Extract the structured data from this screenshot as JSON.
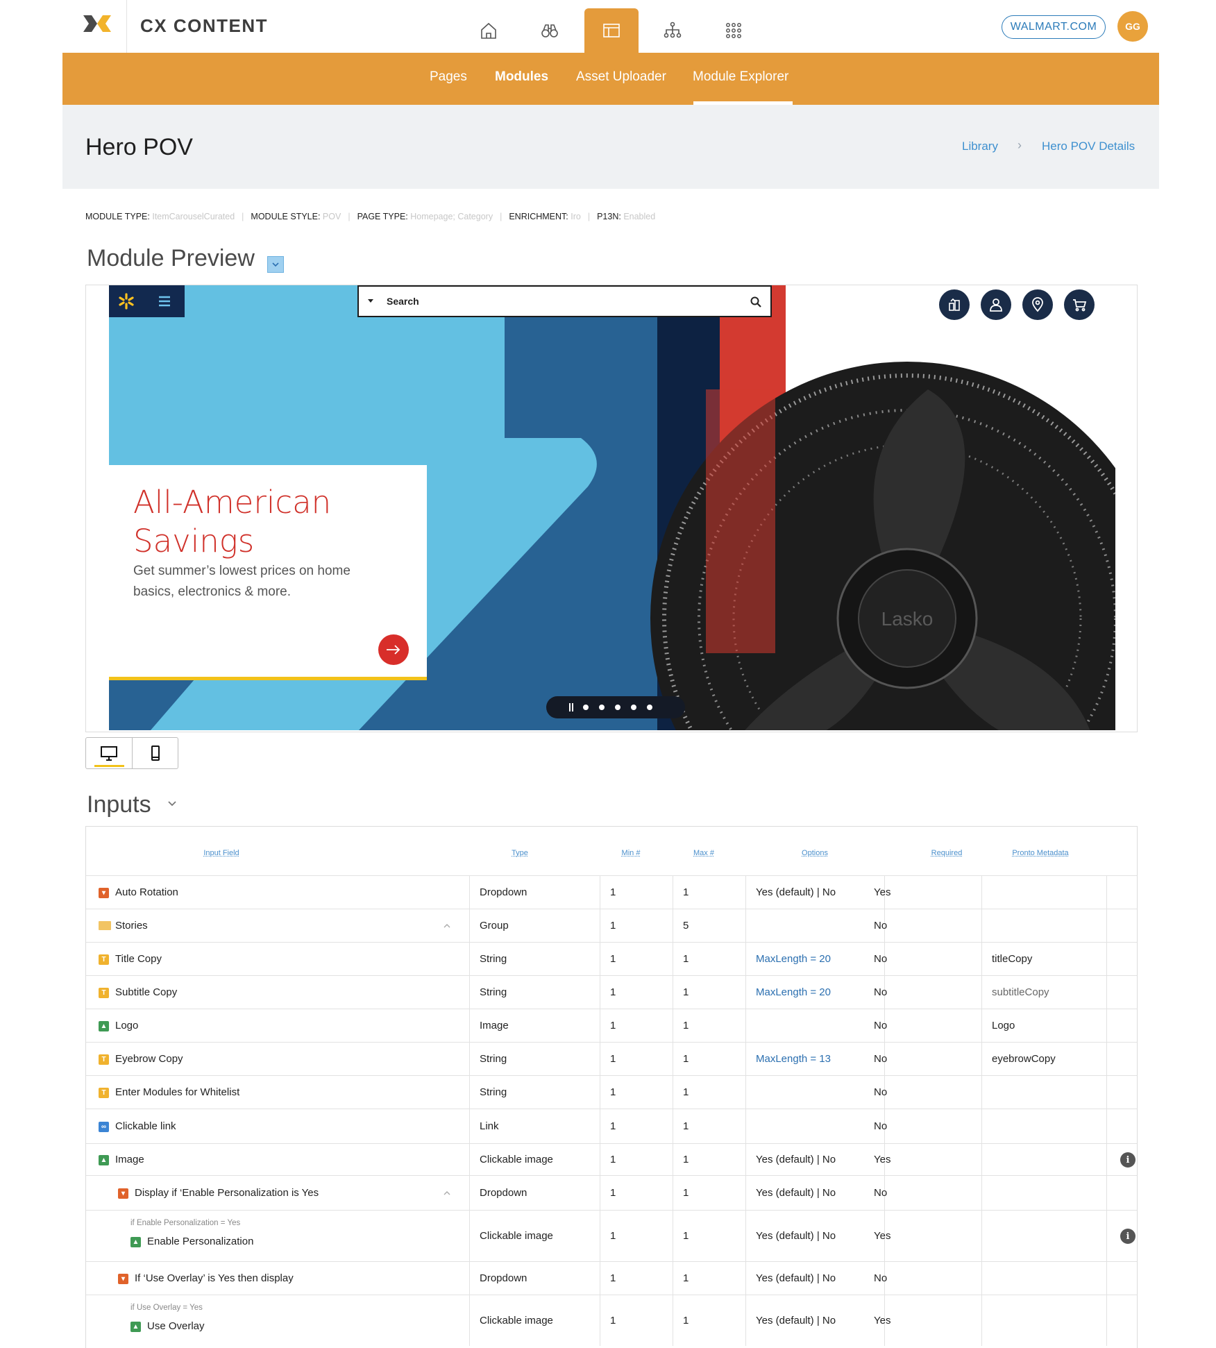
{
  "app": {
    "title": "CX CONTENT",
    "account": "WALMART.COM",
    "avatar_initials": "GG"
  },
  "topnav": {
    "icons": [
      "home-icon",
      "binoculars-icon",
      "layout-icon",
      "sitemap-icon",
      "apps-grid-icon"
    ],
    "active": "layout-icon"
  },
  "subnav": {
    "items": [
      "Pages",
      "Modules",
      "Asset Uploader",
      "Module Explorer"
    ],
    "active": "Module Explorer"
  },
  "page": {
    "title": "Hero POV"
  },
  "breadcrumb": {
    "items": [
      "Library",
      "Hero POV Details"
    ],
    "separator": "›"
  },
  "meta": {
    "module_type_label": "MODULE TYPE:",
    "module_type": "ItemCarouselCurated",
    "module_style_label": "MODULE STYLE:",
    "module_style": "POV",
    "page_type_label": "PAGE TYPE:",
    "page_type": "Homepage; Category",
    "enrichment_label": "ENRICHMENT:",
    "enrichment": "Iro",
    "p13n_label": "P13N:",
    "p13n": "Enabled"
  },
  "preview": {
    "section_title": "Module Preview",
    "search_placeholder": "Search",
    "hero_title_line1": "All-American",
    "hero_title_line2": "Savings",
    "hero_subtitle": "Get summer’s lowest prices on home basics, electronics & more.",
    "fan_brand": "Lasko",
    "pager_dots": 5,
    "device_modes": [
      "desktop-icon",
      "mobile-icon"
    ],
    "active_device": "desktop-icon"
  },
  "colors": {
    "accent": "#e49b3b",
    "link": "#3e90cf",
    "hero_red": "#d0312a",
    "walmart_navy": "#12294f"
  },
  "inputs": {
    "section_title": "Inputs",
    "columns": [
      "Input Field",
      "Type",
      "Min #",
      "Max #",
      "Options",
      "Required",
      "Pronto Metadata"
    ],
    "rows": [
      {
        "field": "Auto Rotation",
        "icon": "dropdown-icon",
        "type": "Dropdown",
        "min": "1",
        "max": "1",
        "options": "Yes (default) | No",
        "required": "Yes",
        "metadata": ""
      },
      {
        "field": "Stories",
        "icon": "folder-icon",
        "type": "Group",
        "min": "1",
        "max": "5",
        "options": "",
        "required": "No",
        "metadata": ""
      },
      {
        "field": "Title Copy",
        "icon": "text-icon",
        "type": "String",
        "min": "1",
        "max": "1",
        "options": "MaxLength = 20",
        "required": "No",
        "metadata": "titleCopy"
      },
      {
        "field": "Subtitle Copy",
        "icon": "text-icon",
        "type": "String",
        "min": "1",
        "max": "1",
        "options": "MaxLength = 20",
        "required": "No",
        "metadata": "subtitleCopy"
      },
      {
        "field": "Logo",
        "icon": "image-icon",
        "type": "Image",
        "min": "1",
        "max": "1",
        "options": "",
        "required": "No",
        "metadata": "Logo"
      },
      {
        "field": "Eyebrow Copy",
        "icon": "text-icon",
        "type": "String",
        "min": "1",
        "max": "1",
        "options": "MaxLength = 13",
        "required": "No",
        "metadata": "eyebrowCopy"
      },
      {
        "field": "Enter Modules for Whitelist",
        "icon": "text-icon",
        "type": "String",
        "min": "1",
        "max": "1",
        "options": "",
        "required": "No",
        "metadata": ""
      },
      {
        "field": "Clickable link",
        "icon": "link-icon",
        "type": "Link",
        "min": "1",
        "max": "1",
        "options": "",
        "required": "No",
        "metadata": ""
      },
      {
        "field": "Image",
        "icon": "image-icon",
        "type": "Clickable image",
        "min": "1",
        "max": "1",
        "options": "Yes (default) | No",
        "required": "Yes",
        "metadata": ""
      },
      {
        "field": "Display if ‘Enable Personalization is Yes",
        "icon": "dropdown-icon",
        "type": "Dropdown",
        "min": "1",
        "max": "1",
        "options": "Yes (default) | No",
        "required": "No",
        "metadata": ""
      },
      {
        "field": "Enable Personalization",
        "condition": "if Enable Personalization = Yes",
        "icon": "image-icon",
        "type": "Clickable image",
        "min": "1",
        "max": "1",
        "options": "Yes (default) | No",
        "required": "Yes",
        "metadata": ""
      },
      {
        "field": "If ‘Use Overlay’ is Yes then display",
        "icon": "dropdown-icon",
        "type": "Dropdown",
        "min": "1",
        "max": "1",
        "options": "Yes (default) | No",
        "required": "No",
        "metadata": ""
      },
      {
        "field": "Use Overlay",
        "condition": "if Use Overlay = Yes",
        "icon": "image-icon",
        "type": "Clickable image",
        "min": "1",
        "max": "1",
        "options": "Yes (default) | No",
        "required": "Yes",
        "metadata": ""
      }
    ]
  }
}
